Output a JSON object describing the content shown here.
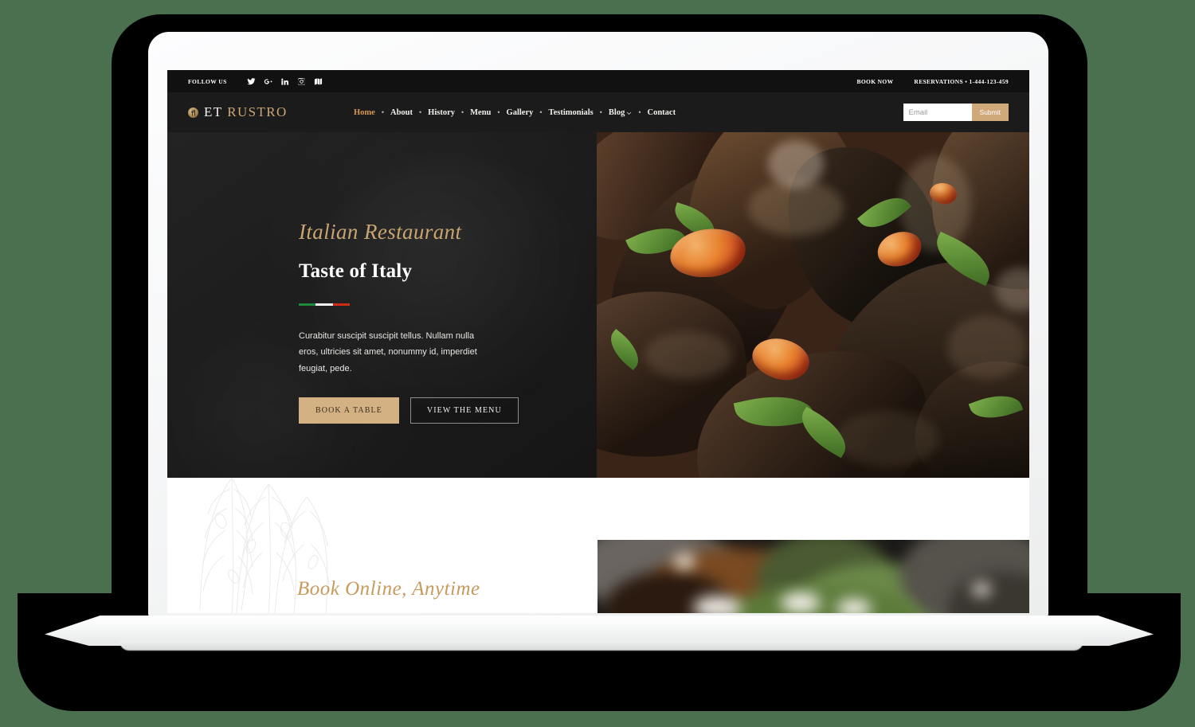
{
  "page": {
    "background_color": "#4a7050",
    "device": "laptop-mockup"
  },
  "site": {
    "topbar": {
      "follow_label": "FOLLOW US",
      "social_icons": [
        {
          "name": "twitter-icon",
          "label": "Twitter"
        },
        {
          "name": "google-plus-icon",
          "label": "Google Plus"
        },
        {
          "name": "linkedin-icon",
          "label": "LinkedIn"
        },
        {
          "name": "instagram-icon",
          "label": "Instagram"
        },
        {
          "name": "map-icon",
          "label": "Map"
        }
      ],
      "book_now": "BOOK NOW",
      "reservations": "RESERVATIONS • 1-444-123-459"
    },
    "header": {
      "brand_first": "ET",
      "brand_second": "RUSTRO",
      "brand_mark_icon": "restaurant-crest-icon",
      "nav": [
        {
          "label": "Home",
          "active": true,
          "dropdown": false
        },
        {
          "label": "About",
          "active": false,
          "dropdown": false
        },
        {
          "label": "History",
          "active": false,
          "dropdown": false
        },
        {
          "label": "Menu",
          "active": false,
          "dropdown": false
        },
        {
          "label": "Gallery",
          "active": false,
          "dropdown": false
        },
        {
          "label": "Testimonials",
          "active": false,
          "dropdown": false
        },
        {
          "label": "Blog",
          "active": false,
          "dropdown": true
        },
        {
          "label": "Contact",
          "active": false,
          "dropdown": false
        }
      ],
      "nav_separator": "•",
      "subscribe": {
        "placeholder": "Email",
        "value": "",
        "submit_label": "Submit"
      }
    },
    "hero": {
      "eyebrow": "Italian Restaurant",
      "title": "Taste of Italy",
      "divider": "italian-flag",
      "body": "Curabitur suscipit suscipit tellus. Nullam nulla eros, ultricies sit amet, nonummy id, imperdiet feugiat, pede.",
      "primary_button": "BOOK A TABLE",
      "secondary_button": "VIEW THE MENU",
      "photo_alt": "Close-up of cooked mussels with cherry tomatoes and parsley"
    },
    "booking_section": {
      "heading": "Book Online, Anytime",
      "watermark": "botanical-leaf-illustration",
      "photo_alt": "Dark moody food photograph with fresh herbs"
    },
    "colors": {
      "gold": "#c8a471",
      "gold_button": "#d4b183",
      "accent_link": "#d79a4e",
      "topbar_bg": "#111111",
      "header_bg": "#1b1b1b",
      "hero_bg": "#1d1d1d",
      "page_bg": "#4a7050"
    }
  }
}
